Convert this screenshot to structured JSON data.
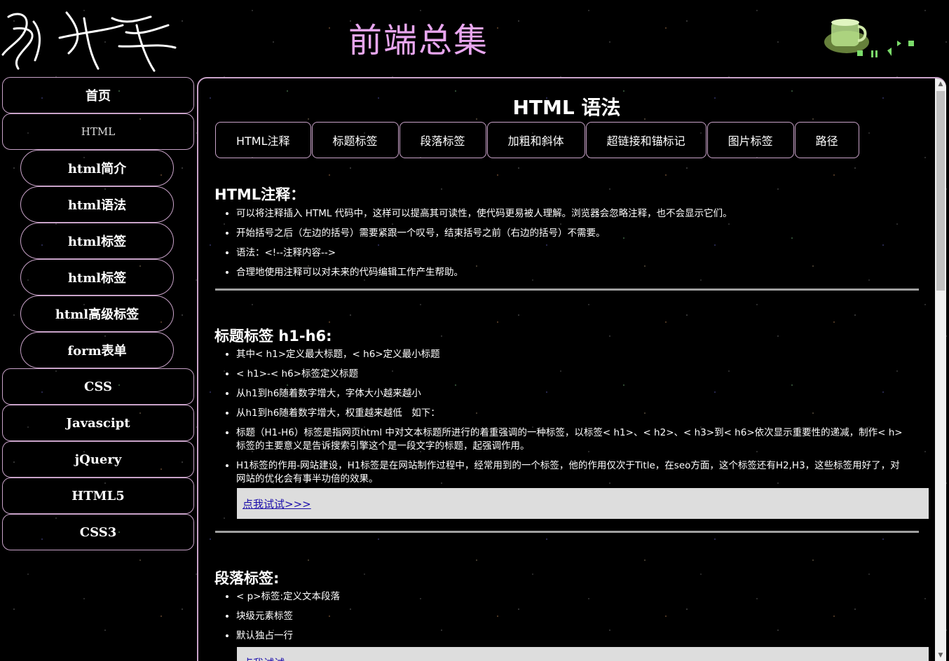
{
  "header": {
    "site_title": "前端总集"
  },
  "sidebar": {
    "items": [
      {
        "label": "首页"
      },
      {
        "label": "HTML"
      },
      {
        "label": "html简介"
      },
      {
        "label": "html语法"
      },
      {
        "label": "html标签"
      },
      {
        "label": "html标签"
      },
      {
        "label": "html高级标签"
      },
      {
        "label": "form表单"
      },
      {
        "label": "CSS"
      },
      {
        "label": "Javascipt"
      },
      {
        "label": "jQuery"
      },
      {
        "label": "HTML5"
      },
      {
        "label": "CSS3"
      }
    ]
  },
  "main": {
    "heading": "HTML 语法",
    "tabs": [
      "HTML注释",
      "标题标签",
      "段落标签",
      "加粗和斜体",
      "超链接和锚标记",
      "图片标签",
      "路径"
    ],
    "sections": [
      {
        "title": "HTML注释：",
        "bullets": [
          "可以将注释插入 HTML 代码中，这样可以提高其可读性，使代码更易被人理解。浏览器会忽略注释，也不会显示它们。",
          "开始括号之后（左边的括号）需要紧跟一个叹号，结束括号之前（右边的括号）不需要。",
          "语法：<!--注释内容-->",
          "合理地使用注释可以对未来的代码编辑工作产生帮助。"
        ]
      },
      {
        "title": "标题标签 h1-h6:",
        "bullets": [
          "其中< h1>定义最大标题，< h6>定义最小标题",
          "< h1>-< h6>标签定义标题",
          "从h1到h6随着数字增大，字体大小越来越小",
          "从h1到h6随着数字增大，权重越来越低　如下：",
          "标题（H1-H6）标签是指网页html 中对文本标题所进行的着重强调的一种标签，以标签< h1>、< h2>、< h3>到< h6>依次显示重要性的递减，制作< h>标签的主要意义是告诉搜索引擎这个是一段文字的标题，起强调作用。",
          "H1标签的作用-网站建设，H1标签是在网站制作过程中，经常用到的一个标签，他的作用仅次于Title，在seo方面，这个标签还有H2,H3，这些标签用好了，对网站的优化会有事半功倍的效果。"
        ],
        "try_link": "点我试试>>>"
      },
      {
        "title": "段落标签:",
        "bullets": [
          "< p>标签:定义文本段落",
          "块级元素标签",
          "默认独占一行"
        ],
        "try_link": "点我试试"
      }
    ]
  },
  "colors": {
    "title_pink": "#e8a6ef",
    "border_pink": "#c9a3c9",
    "background": "#000000",
    "link_blue": "#1a0dab",
    "try_box_bg": "#dddddd"
  }
}
